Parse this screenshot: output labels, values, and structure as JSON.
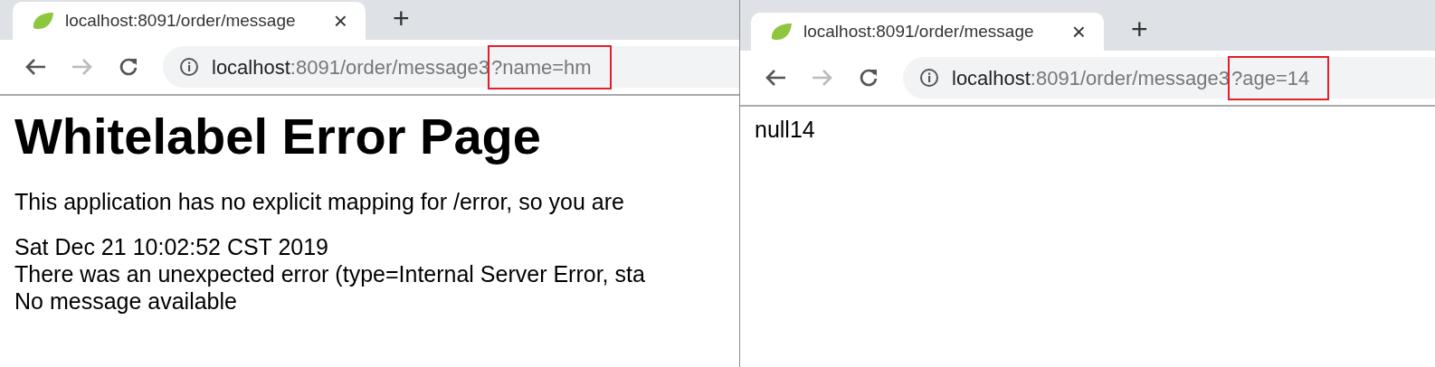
{
  "windows": [
    {
      "tab": {
        "title": "localhost:8091/order/message",
        "close": "×"
      },
      "new_tab": "+",
      "address": {
        "host": "localhost",
        "rest": ":8091/order/message3",
        "query": "?name=hm",
        "query_highlighted": true
      },
      "content": [
        {
          "kind": "heading",
          "text": "Whitelabel Error Page"
        },
        {
          "kind": "paragraph",
          "text": "This application has no explicit mapping for /error, so you are"
        },
        {
          "kind": "line",
          "text": "Sat Dec 21 10:02:52 CST 2019"
        },
        {
          "kind": "line",
          "text": "There was an unexpected error (type=Internal Server Error, sta"
        },
        {
          "kind": "line",
          "text": "No message available"
        }
      ]
    },
    {
      "tab": {
        "title": "localhost:8091/order/message",
        "close": "×"
      },
      "new_tab": "+",
      "address": {
        "host": "localhost",
        "rest": ":8091/order/message3",
        "query": "?age=14",
        "query_highlighted": true
      },
      "content": [
        {
          "kind": "line",
          "text": "null14"
        }
      ]
    }
  ]
}
